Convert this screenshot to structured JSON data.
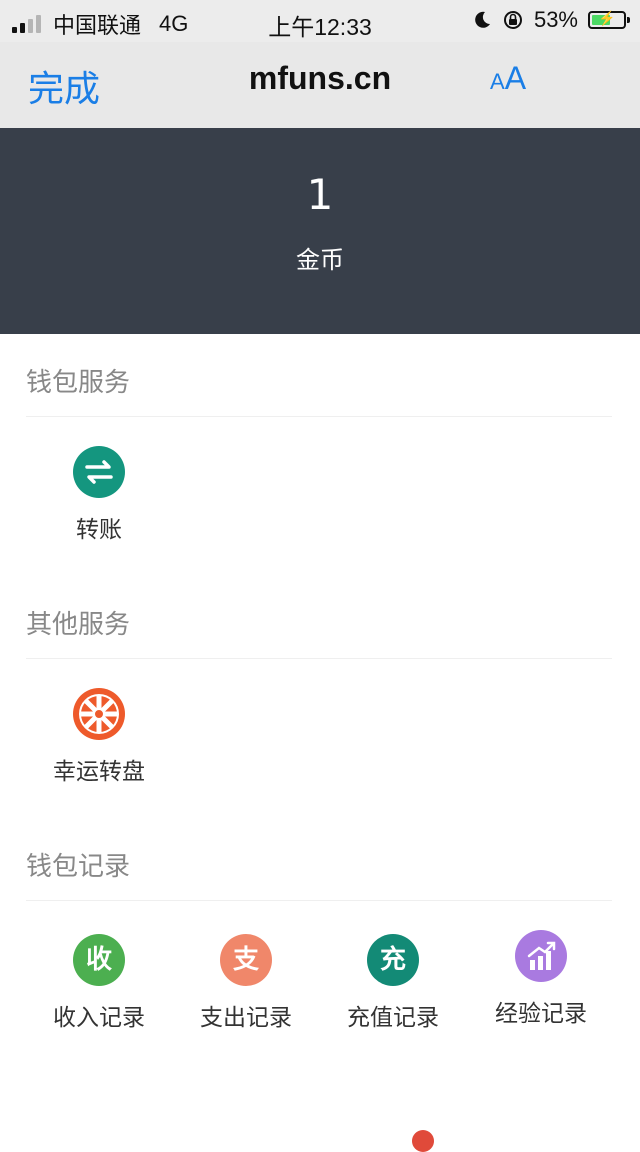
{
  "status_bar": {
    "carrier": "中国联通",
    "network": "4G",
    "time": "上午12:33",
    "battery": "53%"
  },
  "nav": {
    "done_label": "完成",
    "title": "mfuns.cn",
    "text_size_small": "A",
    "text_size_large": "A"
  },
  "wallet": {
    "value": "1",
    "label": "金币"
  },
  "sections": {
    "wallet_services": {
      "title": "钱包服务",
      "items": [
        {
          "label": "转账",
          "icon": "transfer-icon",
          "color": "#14967f"
        }
      ]
    },
    "other_services": {
      "title": "其他服务",
      "items": [
        {
          "label": "幸运转盘",
          "icon": "lucky-wheel-icon",
          "color": "#ee5a2b"
        }
      ]
    },
    "wallet_records": {
      "title": "钱包记录",
      "items": [
        {
          "label": "收入记录",
          "icon_text": "收",
          "color": "#4caf50"
        },
        {
          "label": "支出记录",
          "icon_text": "支",
          "color": "#f0876a"
        },
        {
          "label": "充值记录",
          "icon_text": "充",
          "color": "#138a76"
        },
        {
          "label": "经验记录",
          "icon": "bar-chart-icon",
          "color": "#a97ae0"
        }
      ]
    }
  }
}
